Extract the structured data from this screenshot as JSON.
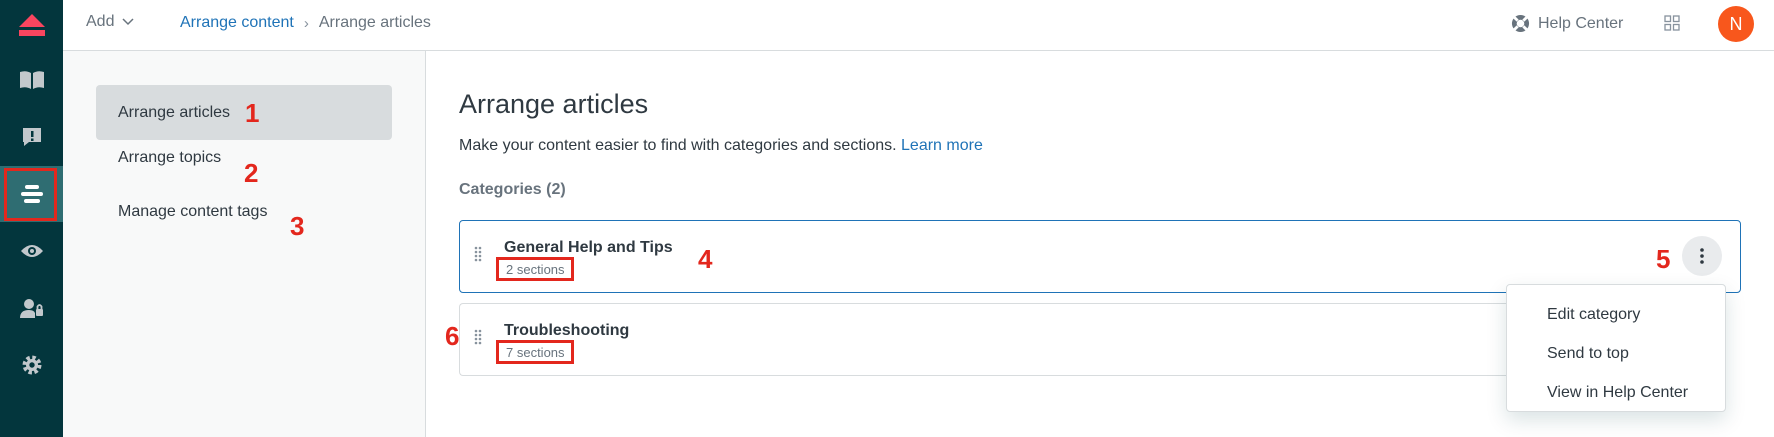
{
  "topbar": {
    "add_label": "Add",
    "breadcrumb": {
      "parent": "Arrange content",
      "current": "Arrange articles"
    },
    "help_center": "Help Center",
    "avatar_initial": "N"
  },
  "sidebar": {
    "items": [
      {
        "label": "Arrange articles"
      },
      {
        "label": "Arrange topics"
      },
      {
        "label": "Manage content tags"
      }
    ]
  },
  "main": {
    "title": "Arrange articles",
    "description": "Make your content easier to find with categories and sections.",
    "learn_more": "Learn more",
    "categories_label": "Categories (2)",
    "categories": [
      {
        "name": "General Help and Tips",
        "sections": "2 sections"
      },
      {
        "name": "Troubleshooting",
        "sections": "7 sections"
      }
    ]
  },
  "menu": {
    "items": [
      {
        "label": "Edit category"
      },
      {
        "label": "Send to top"
      },
      {
        "label": "View in Help Center"
      }
    ]
  },
  "annotations": [
    "1",
    "2",
    "3",
    "4",
    "5",
    "6"
  ],
  "colors": {
    "rail": "#03363d",
    "accent": "#1f73b7",
    "annotation": "#e3271d",
    "avatar": "#f8571c"
  }
}
